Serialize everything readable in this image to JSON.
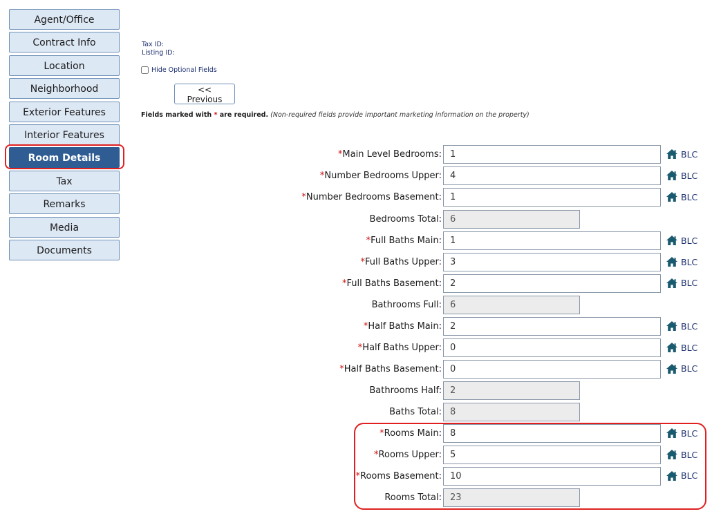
{
  "sidebar": {
    "items": [
      {
        "label": "Agent/Office",
        "active": false
      },
      {
        "label": "Contract Info",
        "active": false
      },
      {
        "label": "Location",
        "active": false
      },
      {
        "label": "Neighborhood",
        "active": false
      },
      {
        "label": "Exterior Features",
        "active": false
      },
      {
        "label": "Interior Features",
        "active": false
      },
      {
        "label": "Room Details",
        "active": true
      },
      {
        "label": "Tax",
        "active": false
      },
      {
        "label": "Remarks",
        "active": false
      },
      {
        "label": "Media",
        "active": false
      },
      {
        "label": "Documents",
        "active": false
      }
    ]
  },
  "header": {
    "tax_id_label": "Tax ID:",
    "listing_id_label": "Listing ID:",
    "hide_optional_label": "Hide Optional Fields",
    "previous_label": "<< Previous",
    "req_note_prefix": "Fields marked with",
    "req_note_star": "*",
    "req_note_suffix": "are required.",
    "req_note_hint": "(Non-required fields provide important marketing information on the property)"
  },
  "blc_label": "BLC",
  "fields": [
    {
      "label": "Main Level Bedrooms:",
      "value": "1",
      "required": true
    },
    {
      "label": "Number Bedrooms Upper:",
      "value": "4",
      "required": true
    },
    {
      "label": "Number Bedrooms Basement:",
      "value": "1",
      "required": true
    },
    {
      "label": "Bedrooms Total:",
      "value": "6",
      "required": false
    },
    {
      "label": "Full Baths Main:",
      "value": "1",
      "required": true
    },
    {
      "label": "Full Baths Upper:",
      "value": "3",
      "required": true
    },
    {
      "label": "Full Baths Basement:",
      "value": "2",
      "required": true
    },
    {
      "label": "Bathrooms Full:",
      "value": "6",
      "required": false
    },
    {
      "label": "Half Baths Main:",
      "value": "2",
      "required": true
    },
    {
      "label": "Half Baths Upper:",
      "value": "0",
      "required": true
    },
    {
      "label": "Half Baths Basement:",
      "value": "0",
      "required": true
    },
    {
      "label": "Bathrooms Half:",
      "value": "2",
      "required": false
    },
    {
      "label": "Baths Total:",
      "value": "8",
      "required": false
    },
    {
      "label": "Rooms Main:",
      "value": "8",
      "required": true
    },
    {
      "label": "Rooms Upper:",
      "value": "5",
      "required": true
    },
    {
      "label": "Rooms Basement:",
      "value": "10",
      "required": true
    },
    {
      "label": "Rooms Total:",
      "value": "23",
      "required": false
    }
  ],
  "colors": {
    "nav_bg": "#dde8f5",
    "nav_active_bg": "#2e5c93",
    "required_star": "#d01010",
    "link_blue": "#1c2f6e",
    "home_icon": "#1a5a6e",
    "highlight": "#e02020"
  }
}
